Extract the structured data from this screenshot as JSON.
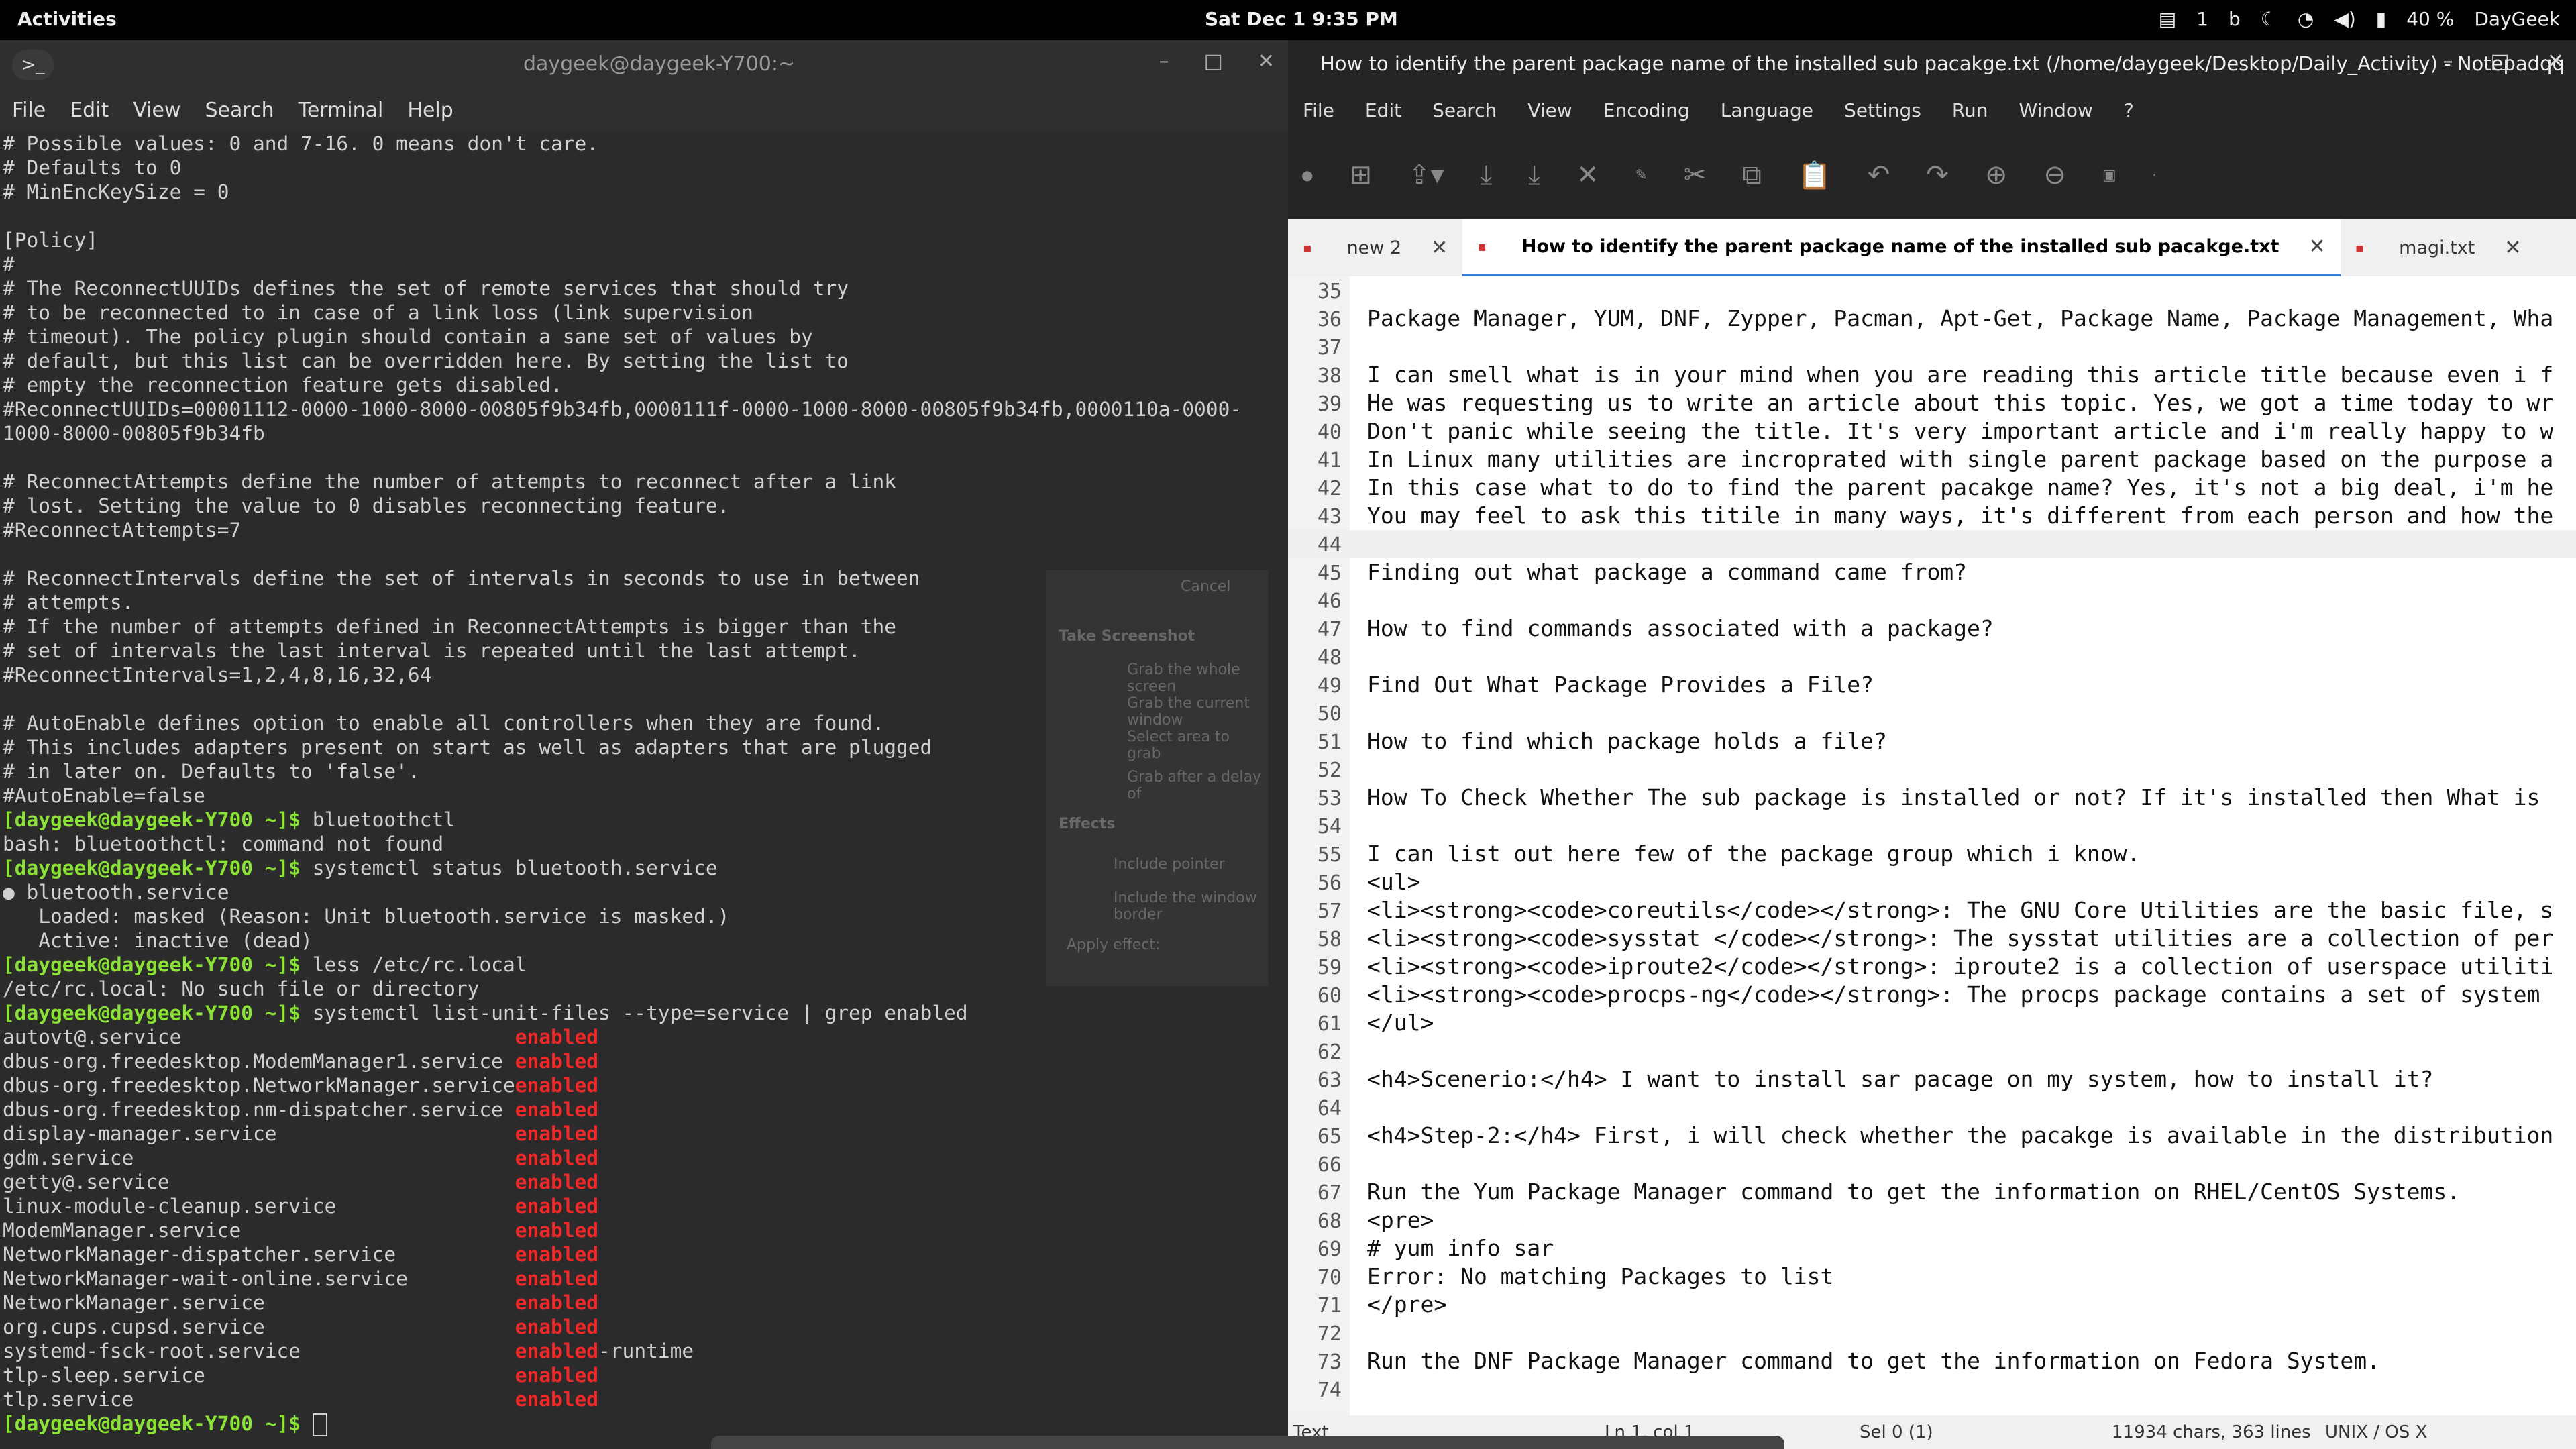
{
  "topbar": {
    "activities": "Activities",
    "clock": "Sat Dec 1   9:35 PM",
    "tray": {
      "updates_count": "1",
      "battery": "40 %",
      "user": "DayGeek"
    }
  },
  "terminal": {
    "title": "daygeek@daygeek-Y700:~",
    "menu": [
      "File",
      "Edit",
      "View",
      "Search",
      "Terminal",
      "Help"
    ],
    "lines": [
      {
        "text": "# Possible values: 0 and 7-16. 0 means don't care."
      },
      {
        "text": "# Defaults to 0"
      },
      {
        "text": "# MinEncKeySize = 0"
      },
      {
        "text": ""
      },
      {
        "text": "[Policy]"
      },
      {
        "text": "#"
      },
      {
        "text": "# The ReconnectUUIDs defines the set of remote services that should try"
      },
      {
        "text": "# to be reconnected to in case of a link loss (link supervision"
      },
      {
        "text": "# timeout). The policy plugin should contain a sane set of values by"
      },
      {
        "text": "# default, but this list can be overridden here. By setting the list to"
      },
      {
        "text": "# empty the reconnection feature gets disabled."
      },
      {
        "text": "#ReconnectUUIDs=00001112-0000-1000-8000-00805f9b34fb,0000111f-0000-1000-8000-00805f9b34fb,0000110a-0000-"
      },
      {
        "text": "1000-8000-00805f9b34fb"
      },
      {
        "text": ""
      },
      {
        "text": "# ReconnectAttempts define the number of attempts to reconnect after a link"
      },
      {
        "text": "# lost. Setting the value to 0 disables reconnecting feature."
      },
      {
        "text": "#ReconnectAttempts=7"
      },
      {
        "text": ""
      },
      {
        "text": "# ReconnectIntervals define the set of intervals in seconds to use in between"
      },
      {
        "text": "# attempts."
      },
      {
        "text": "# If the number of attempts defined in ReconnectAttempts is bigger than the"
      },
      {
        "text": "# set of intervals the last interval is repeated until the last attempt."
      },
      {
        "text": "#ReconnectIntervals=1,2,4,8,16,32,64"
      },
      {
        "text": ""
      },
      {
        "text": "# AutoEnable defines option to enable all controllers when they are found."
      },
      {
        "text": "# This includes adapters present on start as well as adapters that are plugged"
      },
      {
        "text": "# in later on. Defaults to 'false'."
      },
      {
        "text": "#AutoEnable=false"
      },
      {
        "prompt": "[daygeek@daygeek-Y700 ~]$",
        "text": " bluetoothctl"
      },
      {
        "text": "bash: bluetoothctl: command not found"
      },
      {
        "prompt": "[daygeek@daygeek-Y700 ~]$",
        "text": " systemctl status bluetooth.service"
      },
      {
        "text": "● bluetooth.service"
      },
      {
        "text": "   Loaded: masked (Reason: Unit bluetooth.service is masked.)"
      },
      {
        "text": "   Active: inactive (dead)"
      },
      {
        "prompt": "[daygeek@daygeek-Y700 ~]$",
        "text": " less /etc/rc.local"
      },
      {
        "text": "/etc/rc.local: No such file or directory"
      },
      {
        "prompt": "[daygeek@daygeek-Y700 ~]$",
        "text": " systemctl list-unit-files --type=service | grep enabled"
      },
      {
        "text": "autovt@.service                            ",
        "status": "enabled"
      },
      {
        "text": "dbus-org.freedesktop.ModemManager1.service ",
        "status": "enabled"
      },
      {
        "text": "dbus-org.freedesktop.NetworkManager.service",
        "status": "enabled"
      },
      {
        "text": "dbus-org.freedesktop.nm-dispatcher.service ",
        "status": "enabled"
      },
      {
        "text": "display-manager.service                    ",
        "status": "enabled"
      },
      {
        "text": "gdm.service                                ",
        "status": "enabled"
      },
      {
        "text": "getty@.service                             ",
        "status": "enabled"
      },
      {
        "text": "linux-module-cleanup.service               ",
        "status": "enabled"
      },
      {
        "text": "ModemManager.service                       ",
        "status": "enabled"
      },
      {
        "text": "NetworkManager-dispatcher.service          ",
        "status": "enabled"
      },
      {
        "text": "NetworkManager-wait-online.service         ",
        "status": "enabled"
      },
      {
        "text": "NetworkManager.service                     ",
        "status": "enabled"
      },
      {
        "text": "org.cups.cupsd.service                     ",
        "status": "enabled"
      },
      {
        "text": "systemd-fsck-root.service                  ",
        "status": "enabled",
        "suffix": "-runtime"
      },
      {
        "text": "tlp-sleep.service                          ",
        "status": "enabled"
      },
      {
        "text": "tlp.service                                ",
        "status": "enabled"
      },
      {
        "prompt": "[daygeek@daygeek-Y700 ~]$",
        "text": " ",
        "cursor": true
      }
    ],
    "ghost_dialog": {
      "cancel": "Cancel",
      "title": "Take Screenshot",
      "opt1": "Grab the whole screen",
      "opt2": "Grab the current window",
      "opt3": "Select area to grab",
      "delay": "Grab after a delay of",
      "effects": "Effects",
      "pointer": "Include pointer",
      "border": "Include the window border",
      "apply": "Apply effect:"
    }
  },
  "notepad": {
    "title": "How to identify the parent package name of the installed sub pacakge.txt (/home/daygeek/Desktop/Daily_Activity) - Notepadqq",
    "menu": [
      "File",
      "Edit",
      "Search",
      "View",
      "Encoding",
      "Language",
      "Settings",
      "Run",
      "Window",
      "?"
    ],
    "tabs": [
      {
        "label": "new 2",
        "active": false
      },
      {
        "label": "How to identify the parent package name of the installed sub pacakge.txt",
        "active": true
      },
      {
        "label": "magi.txt",
        "active": false
      }
    ],
    "lines": [
      {
        "n": "35",
        "t": ""
      },
      {
        "n": "36",
        "t": "Package Manager, YUM, DNF, Zypper, Pacman, Apt-Get, Package Name, Package Management, Wha"
      },
      {
        "n": "37",
        "t": ""
      },
      {
        "n": "38",
        "t": "I can smell what is in your mind when you are reading this article title because even i f"
      },
      {
        "n": "39",
        "t": "He was requesting us to write an article about this topic. Yes, we got a time today to wr"
      },
      {
        "n": "40",
        "t": "Don't panic while seeing the title. It's very important article and i'm really happy to w"
      },
      {
        "n": "41",
        "t": "In Linux many utilities are incroprated with single parent package based on the purpose a"
      },
      {
        "n": "42",
        "t": "In this case what to do to find the parent pacakge name? Yes, it's not a big deal, i'm he"
      },
      {
        "n": "43",
        "t": "You may feel to ask this titile in many ways, it's different from each person and how the"
      },
      {
        "n": "44",
        "t": "",
        "hl": true
      },
      {
        "n": "45",
        "t": "Finding out what package a command came from?"
      },
      {
        "n": "46",
        "t": ""
      },
      {
        "n": "47",
        "t": "How to find commands associated with a package?"
      },
      {
        "n": "48",
        "t": ""
      },
      {
        "n": "49",
        "t": "Find Out What Package Provides a File?"
      },
      {
        "n": "50",
        "t": ""
      },
      {
        "n": "51",
        "t": "How to find which package holds a file?"
      },
      {
        "n": "52",
        "t": ""
      },
      {
        "n": "53",
        "t": "How To Check Whether The sub package is installed or not? If it's installed then What is"
      },
      {
        "n": "54",
        "t": ""
      },
      {
        "n": "55",
        "t": "I can list out here few of the package group which i know."
      },
      {
        "n": "56",
        "t": "<ul>"
      },
      {
        "n": "57",
        "t": "<li><strong><code>coreutils</code></strong>: The GNU Core Utilities are the basic file, s"
      },
      {
        "n": "58",
        "t": "<li><strong><code>sysstat </code></strong>: The sysstat utilities are a collection of per"
      },
      {
        "n": "59",
        "t": "<li><strong><code>iproute2</code></strong>: iproute2 is a collection of userspace utiliti"
      },
      {
        "n": "60",
        "t": "<li><strong><code>procps-ng</code></strong>: The procps package contains a set of system"
      },
      {
        "n": "61",
        "t": "</ul>"
      },
      {
        "n": "62",
        "t": ""
      },
      {
        "n": "63",
        "t": "<h4>Scenerio:</h4> I want to install sar pacage on my system, how to install it?"
      },
      {
        "n": "64",
        "t": ""
      },
      {
        "n": "65",
        "t": "<h4>Step-2:</h4> First, i will check whether the pacakge is available in the distribution"
      },
      {
        "n": "66",
        "t": ""
      },
      {
        "n": "67",
        "t": "Run the Yum Package Manager command to get the information on RHEL/CentOS Systems."
      },
      {
        "n": "68",
        "t": "<pre>"
      },
      {
        "n": "69",
        "t": "# yum info sar"
      },
      {
        "n": "70",
        "t": "Error: No matching Packages to list"
      },
      {
        "n": "71",
        "t": "</pre>"
      },
      {
        "n": "72",
        "t": ""
      },
      {
        "n": "73",
        "t": "Run the DNF Package Manager command to get the information on Fedora System."
      },
      {
        "n": "74",
        "t": ""
      }
    ],
    "status": {
      "lang": "Text",
      "pos": "Ln 1, col 1",
      "sel": "Sel 0 (1)",
      "chars": "11934 chars, 363 lines",
      "eol": "UNIX / OS X"
    }
  }
}
